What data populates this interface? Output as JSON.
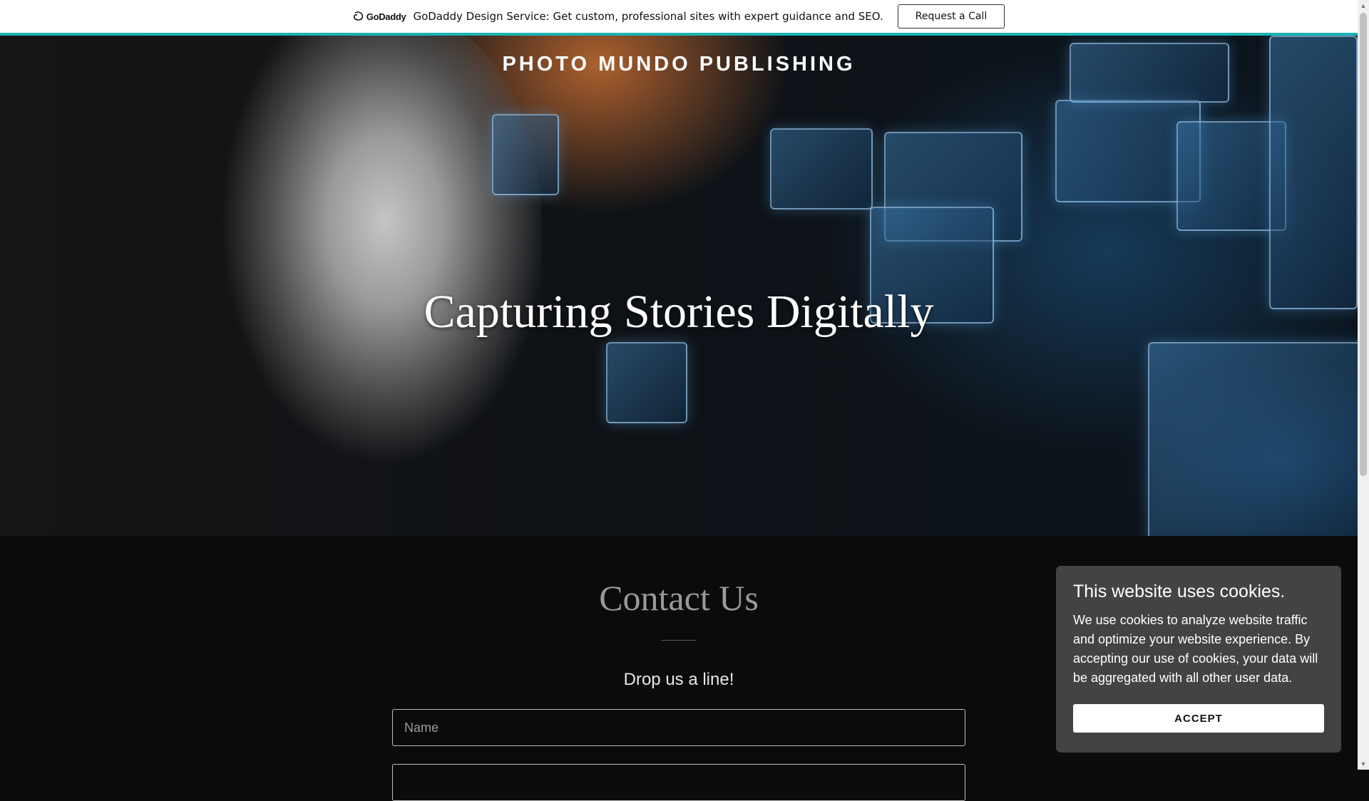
{
  "banner": {
    "logo_text": "GoDaddy",
    "text": "GoDaddy Design Service: Get custom, professional sites with expert guidance and SEO.",
    "button_label": "Request a Call"
  },
  "hero": {
    "site_title": "PHOTO MUNDO PUBLISHING",
    "heading": "Capturing Stories Digitally"
  },
  "contact": {
    "title": "Contact Us",
    "subtitle": "Drop us a line!",
    "name_placeholder": "Name",
    "email_placeholder": ""
  },
  "cookie": {
    "title": "This website uses cookies.",
    "body": "We use cookies to analyze website traffic and optimize your website experience. By accepting our use of cookies, your data will be aggregated with all other user data.",
    "accept_label": "ACCEPT"
  },
  "colors": {
    "accent": "#1bb3b3",
    "popup_bg": "#434343",
    "page_bg": "#0b0b0b"
  }
}
